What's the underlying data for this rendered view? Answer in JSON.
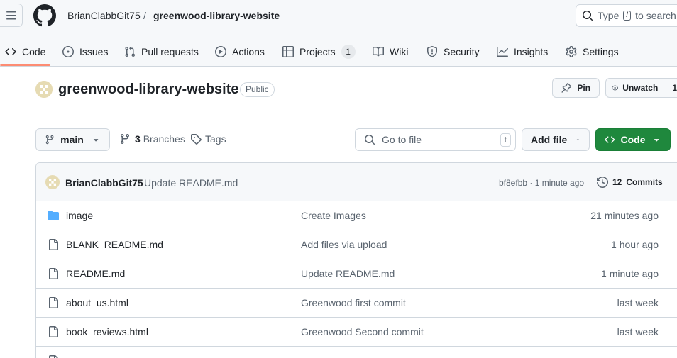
{
  "header": {
    "owner": "BrianClabbGit75",
    "separator": "/",
    "repo": "greenwood-library-website",
    "search_label": "Type",
    "search_key": "/",
    "search_suffix": "to search"
  },
  "nav": {
    "items": [
      {
        "label": "Code",
        "icon": "code-icon",
        "active": true
      },
      {
        "label": "Issues",
        "icon": "issue-icon"
      },
      {
        "label": "Pull requests",
        "icon": "pull-request-icon"
      },
      {
        "label": "Actions",
        "icon": "play-icon"
      },
      {
        "label": "Projects",
        "icon": "table-icon",
        "count": "1"
      },
      {
        "label": "Wiki",
        "icon": "book-icon"
      },
      {
        "label": "Security",
        "icon": "shield-icon"
      },
      {
        "label": "Insights",
        "icon": "graph-icon"
      },
      {
        "label": "Settings",
        "icon": "gear-icon"
      }
    ],
    "active_color": "#fd8c73"
  },
  "repo": {
    "title": "greenwood-library-website",
    "visibility": "Public",
    "pin_label": "Pin",
    "watch_label": "Unwatch",
    "watch_count": "1"
  },
  "toolbar": {
    "branch": "main",
    "branches_count": "3",
    "branches_label": "Branches",
    "tags_label": "Tags",
    "goto_placeholder": "Go to file",
    "goto_key": "t",
    "add_file_label": "Add file",
    "code_label": "Code",
    "code_color": "#1f883d"
  },
  "latest_commit": {
    "author": "BrianClabbGit75",
    "message": "Update README.md",
    "sha_time": "bf8efbb · 1 minute ago",
    "commits_count": "12",
    "commits_label": "Commits"
  },
  "files": [
    {
      "type": "folder",
      "name": "image",
      "message": "Create Images",
      "date": "21 minutes ago"
    },
    {
      "type": "file",
      "name": "BLANK_README.md",
      "message": "Add files via upload",
      "date": "1 hour ago"
    },
    {
      "type": "file",
      "name": "README.md",
      "message": "Update README.md",
      "date": "1 minute ago"
    },
    {
      "type": "file",
      "name": "about_us.html",
      "message": "Greenwood first commit",
      "date": "last week"
    },
    {
      "type": "file",
      "name": "book_reviews.html",
      "message": "Greenwood Second commit",
      "date": "last week"
    }
  ],
  "colors": {
    "folder": "#54aeff",
    "border": "#d0d7de",
    "muted": "#59636e"
  }
}
